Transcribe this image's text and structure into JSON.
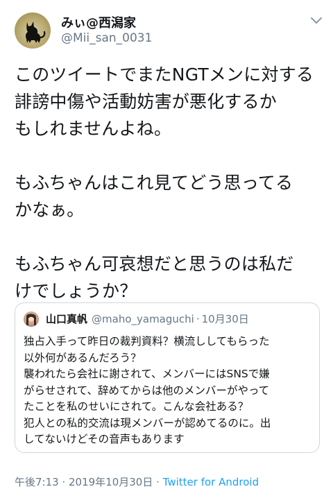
{
  "tweet": {
    "display_name": "みぃ@西潟家",
    "handle": "@Mii_san_0031",
    "text": "このツイートでまたNGTメンに対する\n誹謗中傷や活動妨害が悪化するか\nもしれませんよね。\n\nもふちゃんはこれ見てどう思ってる\nかなぁ。\n\nもふちゃん可哀想だと思うのは私だ\nけでしょうか？",
    "icons": {
      "avatar": "black-cat-avatar",
      "menu": "chevron-down-icon"
    }
  },
  "quote": {
    "name": "山口真帆",
    "handle": "@maho_yamaguchi",
    "separator": "·",
    "date": "10月30日",
    "text": "独占入手って昨日の裁判資料？横流ししてもらった\n以外何があるんだろう？\n襲われたら会社に謝されて、メンバーにはSNSで嫌\nがらせされて、辞めてからは他のメンバーがやって\nたことを私のせいにされて。こんな会社ある？\n犯人との私的交流は現メンバーが認めてるのに。出\nしてないけどその音声もあります"
  },
  "footer": {
    "time": "午後7:13",
    "separator1": " · ",
    "date": "2019年10月30日",
    "separator2": " · ",
    "via": "Twitter for Android"
  },
  "colors": {
    "text": "#14171a",
    "secondary": "#657786",
    "link": "#1da1f2",
    "border": "#ccd6dd"
  }
}
